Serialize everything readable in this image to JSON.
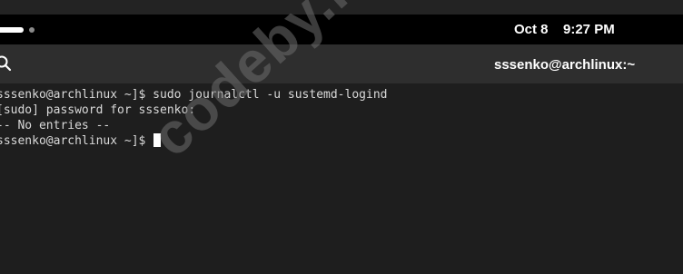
{
  "top_bar": {
    "date": "Oct 8",
    "time": "9:27 PM"
  },
  "header": {
    "title": "sssenko@archlinux:~",
    "search_icon": "search-icon"
  },
  "terminal": {
    "lines": [
      "sssenko@archlinux ~]$ sudo journalctl -u sustemd-logind",
      "[sudo] password for sssenko:",
      "-- No entries --",
      "sssenko@archlinux ~]$ "
    ]
  },
  "watermark": {
    "text": "codeby.net"
  },
  "colors": {
    "terminal_bg": "#1e1e1e",
    "header_bg": "#2e2e2e",
    "topbar_bg": "#000000",
    "text": "#d9d9d9"
  }
}
